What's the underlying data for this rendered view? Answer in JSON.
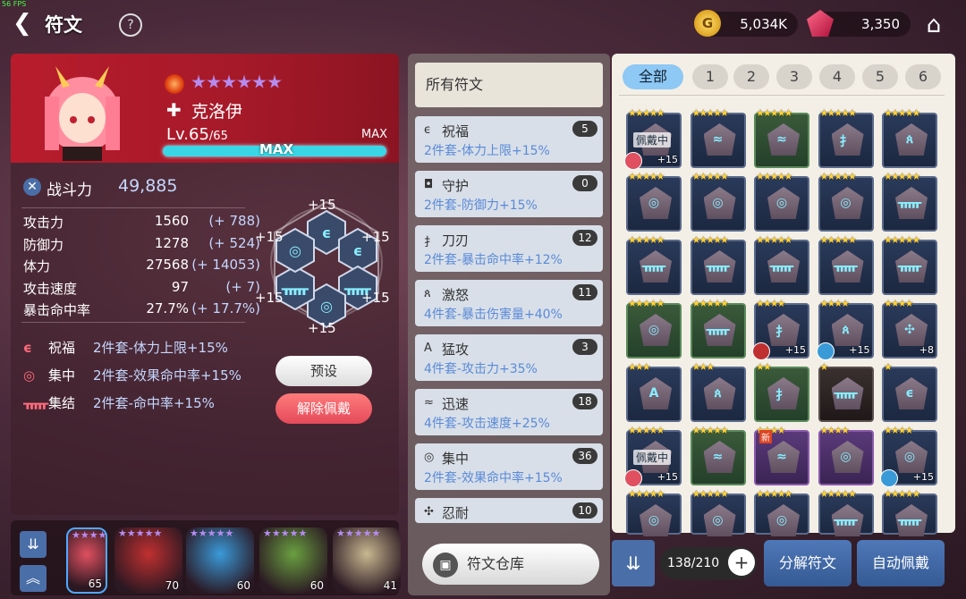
{
  "fps": "56 FPS",
  "header": {
    "title": "符文",
    "gold": "5,034K",
    "gems": "3,350"
  },
  "hero": {
    "name": "克洛伊",
    "level": "Lv.65",
    "level_max": "/65",
    "max_label": "MAX",
    "xp_label": "MAX",
    "combat_label": "战斗力",
    "combat_power": "49,885",
    "stars": 6
  },
  "stats": [
    {
      "k": "攻击力",
      "v": "1560",
      "b": "(+ 788)"
    },
    {
      "k": "防御力",
      "v": "1278",
      "b": "(+ 524)"
    },
    {
      "k": "体力",
      "v": "27568",
      "b": "(+ 14053)"
    },
    {
      "k": "攻击速度",
      "v": "97",
      "b": "(+ 7)"
    },
    {
      "k": "暴击命中率",
      "v": "27.7%",
      "b": "(+ 17.7%)"
    }
  ],
  "set_bonuses": [
    {
      "icon": "ϵ",
      "name": "祝福",
      "desc": "2件套-体力上限+15%"
    },
    {
      "icon": "◎",
      "name": "集中",
      "desc": "2件套-效果命中率+15%"
    },
    {
      "icon": "ᚅ",
      "name": "集结",
      "desc": "2件套-命中率+15%"
    }
  ],
  "hex_plus": [
    "+15",
    "+15",
    "+15",
    "+15",
    "+15",
    "+15"
  ],
  "buttons": {
    "preset": "预设",
    "unequip": "解除佩戴",
    "warehouse": "符文仓库",
    "decompose": "分解符文",
    "auto_equip": "自动佩戴"
  },
  "roster": [
    {
      "level": "65",
      "color": "#e05060"
    },
    {
      "level": "70",
      "color": "#c03030"
    },
    {
      "level": "60",
      "color": "#3a9ad8"
    },
    {
      "level": "60",
      "color": "#6aa040"
    },
    {
      "level": "41",
      "color": "#c8b890"
    }
  ],
  "sets_header": "所有符文",
  "sets": [
    {
      "icon": "ϵ",
      "name": "祝福",
      "count": "5",
      "desc": "2件套-体力上限+15%"
    },
    {
      "icon": "◘",
      "name": "守护",
      "count": "0",
      "desc": "2件套-防御力+15%"
    },
    {
      "icon": "扌",
      "name": "刀刃",
      "count": "12",
      "desc": "2件套-暴击命中率+12%"
    },
    {
      "icon": "ጰ",
      "name": "激怒",
      "count": "11",
      "desc": "4件套-暴击伤害量+40%"
    },
    {
      "icon": "A",
      "name": "猛攻",
      "count": "3",
      "desc": "4件套-攻击力+35%"
    },
    {
      "icon": "≈",
      "name": "迅速",
      "count": "18",
      "desc": "4件套-攻击速度+25%"
    },
    {
      "icon": "◎",
      "name": "集中",
      "count": "36",
      "desc": "2件套-效果命中率+15%"
    },
    {
      "icon": "✣",
      "name": "忍耐",
      "count": "10",
      "desc": ""
    }
  ],
  "filters": [
    "全部",
    "1",
    "2",
    "3",
    "4",
    "5",
    "6"
  ],
  "equipped_label": "佩戴中",
  "new_label": "新",
  "runes": [
    {
      "stars": "★★★★★",
      "type": "",
      "glyph": "",
      "plus": "+15",
      "eq": true,
      "av": "#e05060"
    },
    {
      "stars": "★★★★★",
      "type": "",
      "glyph": "≈"
    },
    {
      "stars": "★★★★★",
      "type": "green",
      "glyph": "≈"
    },
    {
      "stars": "★★★★★",
      "type": "",
      "glyph": "扌"
    },
    {
      "stars": "★★★★★",
      "type": "",
      "glyph": "ጰ"
    },
    {
      "stars": "★★★★★",
      "type": "",
      "glyph": "◎"
    },
    {
      "stars": "★★★★★",
      "type": "",
      "glyph": "◎"
    },
    {
      "stars": "★★★★★",
      "type": "",
      "glyph": "◎"
    },
    {
      "stars": "★★★★★",
      "type": "",
      "glyph": "◎"
    },
    {
      "stars": "★★★★★",
      "type": "",
      "glyph": "ᚅ"
    },
    {
      "stars": "★★★★★",
      "type": "",
      "glyph": "ᚅ"
    },
    {
      "stars": "★★★★★",
      "type": "",
      "glyph": "ᚅ"
    },
    {
      "stars": "★★★★★",
      "type": "",
      "glyph": "ᚅ"
    },
    {
      "stars": "★★★★★",
      "type": "",
      "glyph": "ᚅ"
    },
    {
      "stars": "★★★★★",
      "type": "",
      "glyph": "ᚅ"
    },
    {
      "stars": "★★★★★",
      "type": "green",
      "glyph": "◎"
    },
    {
      "stars": "★★★★★",
      "type": "green",
      "glyph": "ᚅ"
    },
    {
      "stars": "★★★★",
      "type": "",
      "glyph": "扌",
      "plus": "+15",
      "av": "#c03030"
    },
    {
      "stars": "★★★★",
      "type": "",
      "glyph": "ጰ",
      "plus": "+15",
      "av": "#3a9ad8"
    },
    {
      "stars": "★★★★",
      "type": "",
      "glyph": "✣",
      "plus": "+8"
    },
    {
      "stars": "★★★",
      "type": "",
      "glyph": "A"
    },
    {
      "stars": "★★★",
      "type": "",
      "glyph": "ጰ"
    },
    {
      "stars": "★★",
      "type": "green",
      "glyph": "扌"
    },
    {
      "stars": "★",
      "type": "dark",
      "glyph": "ᚅ"
    },
    {
      "stars": "★",
      "type": "",
      "glyph": "ϵ"
    },
    {
      "stars": "★★★★★",
      "type": "",
      "glyph": "",
      "plus": "+15",
      "eq": true,
      "av": "#e05060"
    },
    {
      "stars": "★★★★★",
      "type": "green",
      "glyph": "≈"
    },
    {
      "stars": "★★★★",
      "type": "purple",
      "glyph": "≈",
      "new": true
    },
    {
      "stars": "★★★★",
      "type": "purple",
      "glyph": "◎"
    },
    {
      "stars": "★★★★",
      "type": "",
      "glyph": "◎",
      "plus": "+15",
      "av": "#3a9ad8"
    },
    {
      "stars": "★★★★★",
      "type": "",
      "glyph": "◎"
    },
    {
      "stars": "★★★★★",
      "type": "",
      "glyph": "◎"
    },
    {
      "stars": "★★★★★",
      "type": "",
      "glyph": "◎"
    },
    {
      "stars": "★★★★★",
      "type": "",
      "glyph": "ᚅ"
    },
    {
      "stars": "★★★★★",
      "type": "",
      "glyph": "ᚅ"
    }
  ],
  "capacity": "138/210",
  "colors": {
    "accent": "#3bd6e6",
    "header_red": "#b81c2c",
    "button_blue": "#4a6ea8",
    "bonus_text": "#c4d8ff",
    "set_desc": "#5a8ad8"
  }
}
